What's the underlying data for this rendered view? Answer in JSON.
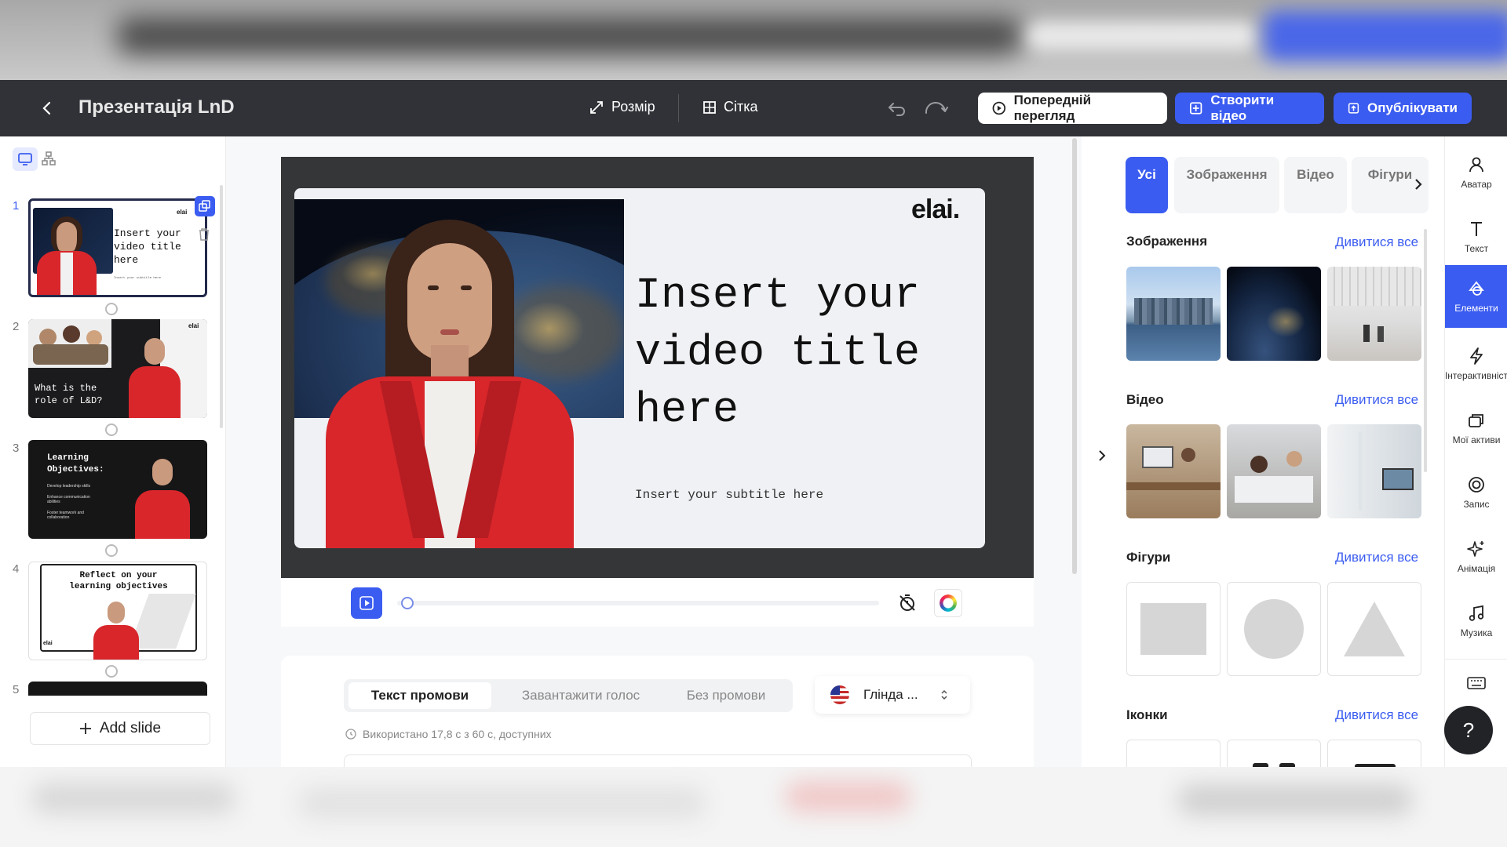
{
  "header": {
    "back_icon": "chevron-left-icon",
    "title": "Презентація LnD",
    "size_label": "Розмір",
    "grid_label": "Сітка",
    "preview_label": "Попередній перегляд",
    "create_video_label": "Створити відео",
    "publish_label": "Опублікувати"
  },
  "slides_panel": {
    "slides": [
      {
        "number": "1",
        "title": "Insert your video title here",
        "subtitle": "Insert your subtitle here",
        "logo": "elai"
      },
      {
        "number": "2",
        "title": "What is the role of L&D?",
        "logo": "elai"
      },
      {
        "number": "3",
        "title": "Learning Objectives:",
        "bullets": [
          "Develop leadership skills",
          "Enhance communication abilities",
          "Foster teamwork and collaboration"
        ]
      },
      {
        "number": "4",
        "title": "Reflect on your learning objectives",
        "logo": "elai"
      },
      {
        "number": "5"
      }
    ],
    "add_slide_label": "Add slide"
  },
  "canvas": {
    "logo": "elai.",
    "title": "Insert your video title here",
    "subtitle": "Insert your subtitle here"
  },
  "script": {
    "tabs": [
      "Текст промови",
      "Завантажити голос",
      "Без промови"
    ],
    "voice_name": "Глінда ...",
    "usage_text": "Використано 17,8 с з 60 с, доступних"
  },
  "elements_panel": {
    "tabs": [
      "Усі",
      "Зображення",
      "Відео",
      "Фігури"
    ],
    "sections": {
      "images": {
        "title": "Зображення",
        "link": "Дивитися все"
      },
      "videos": {
        "title": "Відео",
        "link": "Дивитися все"
      },
      "shapes": {
        "title": "Фігури",
        "link": "Дивитися все"
      },
      "icons": {
        "title": "Іконки",
        "link": "Дивитися все"
      }
    }
  },
  "sidebar_icons": [
    {
      "label": "Аватар",
      "icon": "avatar-icon"
    },
    {
      "label": "Текст",
      "icon": "text-icon"
    },
    {
      "label": "Елементи",
      "icon": "elements-icon"
    },
    {
      "label": "Інтерактивніст",
      "icon": "lightning-icon"
    },
    {
      "label": "Мої активи",
      "icon": "assets-icon"
    },
    {
      "label": "Запис",
      "icon": "record-icon"
    },
    {
      "label": "Анімація",
      "icon": "sparkle-icon"
    },
    {
      "label": "Музика",
      "icon": "music-icon"
    }
  ],
  "colors": {
    "accent": "#3b5cf0",
    "topbar": "#303237",
    "canvas_bg": "#343638",
    "red_jacket": "#d8262b"
  }
}
